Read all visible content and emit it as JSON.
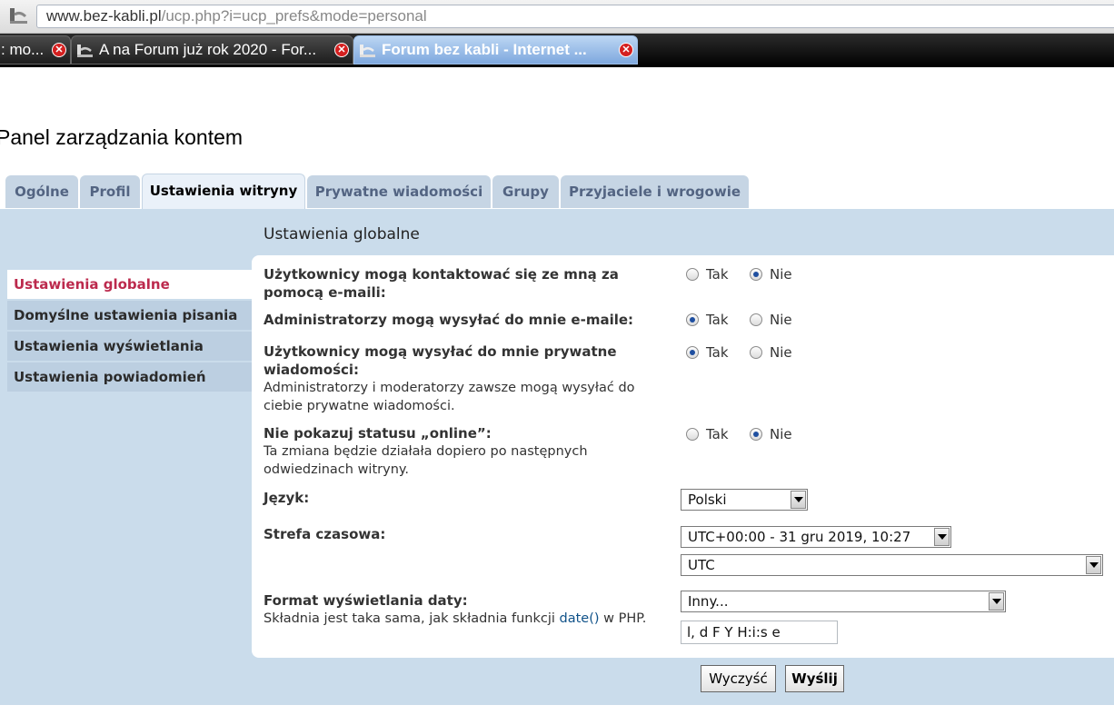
{
  "browser": {
    "url_host": "www.bez-kabli.pl",
    "url_path": "/ucp.php?i=ucp_prefs&mode=personal",
    "tabs": [
      {
        "label": ": mo..."
      },
      {
        "label": "A na Forum już rok 2020 - For..."
      },
      {
        "label": "Forum bez kabli - Internet ..."
      }
    ]
  },
  "page": {
    "title": "Panel zarządzania kontem",
    "tabs": [
      "Ogólne",
      "Profil",
      "Ustawienia witryny",
      "Prywatne wiadomości",
      "Grupy",
      "Przyjaciele i wrogowie"
    ],
    "section_title": "Ustawienia globalne"
  },
  "sidebar": {
    "items": [
      "Ustawienia globalne",
      "Domyślne ustawienia pisania",
      "Ustawienia wyświetlania",
      "Ustawienia powiadomień"
    ]
  },
  "form": {
    "yes": "Tak",
    "no": "Nie",
    "email_contact": {
      "label_1": "Użytkownicy mogą kontaktować się ze mną za",
      "label_2": "pomocą e-maili:",
      "value": "no"
    },
    "admin_email": {
      "label": "Administratorzy mogą wysyłać do mnie e-maile:",
      "value": "yes"
    },
    "private_messages": {
      "label_1": "Użytkownicy mogą wysyłać do mnie prywatne",
      "label_2": "wiadomości:",
      "expl_1": "Administratorzy i moderatorzy zawsze mogą wysyłać do",
      "expl_2": "ciebie prywatne wiadomości.",
      "value": "yes"
    },
    "hide_online": {
      "label": "Nie pokazuj statusu „online”:",
      "expl_1": "Ta zmiana będzie działała dopiero po następnych",
      "expl_2": "odwiedzinach witryny.",
      "value": "no"
    },
    "language": {
      "label": "Język:",
      "selected": "Polski"
    },
    "timezone": {
      "label": "Strefa czasowa:",
      "selected_offset": "UTC+00:00 - 31 gru 2019, 10:27",
      "selected_zone": "UTC"
    },
    "date_format": {
      "label": "Format wyświetlania daty:",
      "expl_pre": "Składnia jest taka sama, jak składnia funkcji ",
      "expl_link": "date()",
      "expl_post": " w PHP.",
      "selected": "Inny...",
      "custom_value": "l, d F Y H:i:s e"
    }
  },
  "buttons": {
    "reset": "Wyczyść",
    "submit": "Wyślij"
  },
  "colors": {
    "tab_bg": "#c6d5e4",
    "panel_bg": "#cadceb",
    "active_link": "#bc2a4d",
    "link": "#105289"
  }
}
